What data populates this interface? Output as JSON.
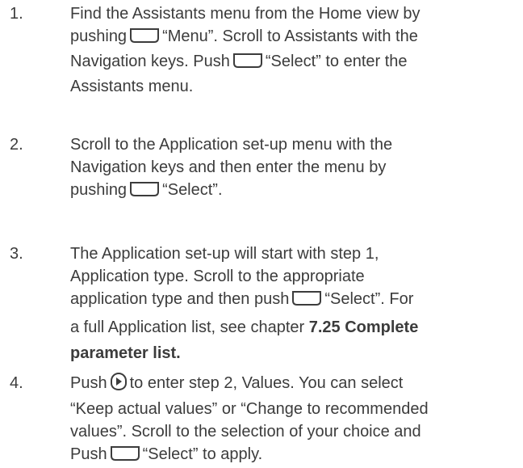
{
  "steps": [
    {
      "number": "1.",
      "lines": {
        "l1": "Find the Assistants menu from the Home view by",
        "l2a": "pushing",
        "l2b": "“Menu”. Scroll to Assistants with the",
        "l3a": "Navigation keys. Push",
        "l3b": "“Select” to enter the",
        "l4": "Assistants menu."
      }
    },
    {
      "number": "2.",
      "lines": {
        "l1": "Scroll to the Application set-up menu with the",
        "l2": "Navigation keys and then enter the menu by",
        "l3a": "pushing",
        "l3b": "“Select”."
      }
    },
    {
      "number": "3.",
      "lines": {
        "l1": "The Application set-up will start with step 1,",
        "l2": "Application type. Scroll to the appropriate",
        "l3a": "application type and then push",
        "l3b": "“Select”. For",
        "l4a": "a full Application list, see chapter",
        "l4b": "7.25 Complete",
        "l5": "parameter list."
      }
    },
    {
      "number": "4.",
      "lines": {
        "l1a": "Push",
        "l1b": "to enter step 2, Values. You can select",
        "l2": "“Keep actual values” or “Change to recommended",
        "l3": "values”. Scroll to the selection of your choice and",
        "l4a": "Push",
        "l4b": "“Select” to apply."
      }
    }
  ],
  "icons": {
    "soft_key": "soft-key-icon",
    "nav_right": "navigation-right-key-icon"
  }
}
